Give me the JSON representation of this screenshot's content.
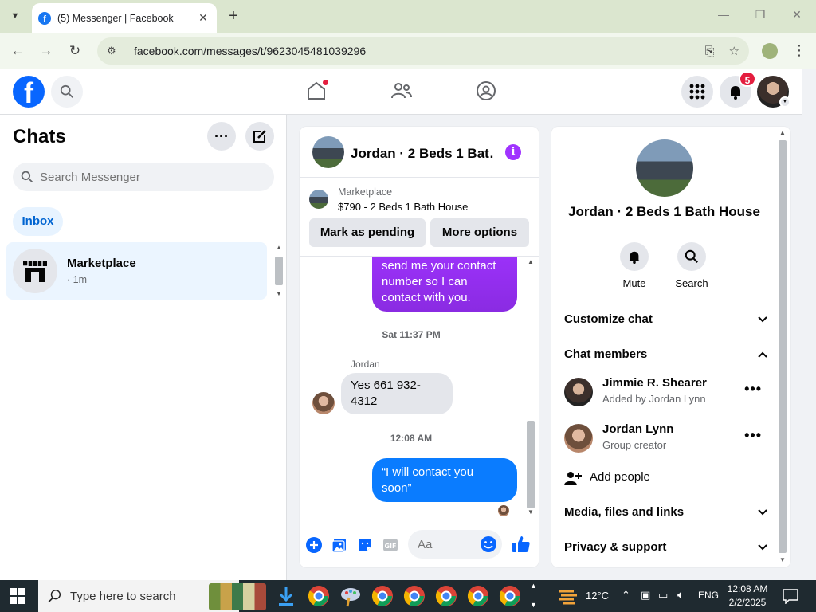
{
  "browser": {
    "tab_title": "(5) Messenger | Facebook",
    "url": "facebook.com/messages/t/9623045481039296"
  },
  "header": {
    "notifications_count": "5"
  },
  "chats": {
    "title": "Chats",
    "search_placeholder": "Search Messenger",
    "filter_label": "Inbox",
    "threads": [
      {
        "name": "Marketplace",
        "meta": "· 1m"
      }
    ]
  },
  "conversation": {
    "title": "Jordan · 2 Beds 1 Bat…",
    "listing": {
      "label": "Marketplace",
      "price_title": "$790 - 2 Beds 1 Bath House"
    },
    "buttons": {
      "mark_pending": "Mark as pending",
      "more_options": "More options"
    },
    "messages": [
      {
        "text_line1": "send me your contact",
        "text_line2": "number so I can",
        "text_line3": "contact with you."
      },
      {
        "timestamp": "Sat 11:37 PM"
      },
      {
        "sender": "Jordan",
        "text_line1": "Yes 661 932-",
        "text_line2": "4312"
      },
      {
        "timestamp": "12:08 AM"
      },
      {
        "text_line1": "“I will contact you",
        "text_line2": "soon”"
      }
    ],
    "composer_placeholder": "Aa"
  },
  "info_panel": {
    "name": "Jordan · 2 Beds 1 Bath House",
    "actions": {
      "mute": "Mute",
      "search": "Search"
    },
    "sections": {
      "customize": "Customize chat",
      "members": "Chat members",
      "media": "Media, files and links",
      "privacy": "Privacy & support"
    },
    "members": [
      {
        "name": "Jimmie R. Shearer",
        "subtitle": "Added by Jordan Lynn"
      },
      {
        "name": "Jordan Lynn",
        "subtitle": "Group creator"
      }
    ],
    "add_people": "Add people"
  },
  "taskbar": {
    "search_placeholder": "Type here to search",
    "weather": "12°C",
    "language": "ENG",
    "time": "12:08 AM",
    "date": "2/2/2025"
  },
  "colors": {
    "facebook_blue": "#0866ff",
    "purple_bubble": "#a033ff",
    "blue_bubble": "#0a7cff",
    "badge_red": "#e41e3f"
  }
}
